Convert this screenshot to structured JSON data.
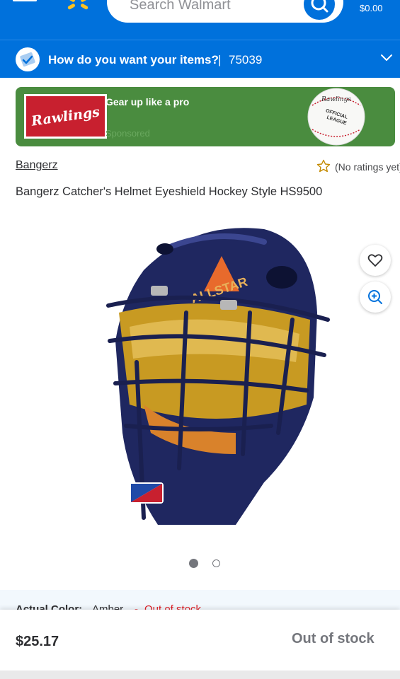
{
  "header": {
    "search_placeholder": "Search Walmart",
    "cart_total": "$0.00"
  },
  "delivery": {
    "question": "How do you want your items?",
    "separator": "|",
    "zip": "75039"
  },
  "banner": {
    "logo_text": "Rawlings",
    "title": "Gear up like a pro",
    "sponsored": "Sponsored",
    "ball_text_1": "Rawlings",
    "ball_text_2": "OFFICIAL",
    "ball_text_3": "LEAGUE"
  },
  "product": {
    "brand": "Bangerz",
    "rating_text": "(No ratings yet)",
    "title": "Bangerz Catcher's Helmet Eyeshield Hockey Style HS9500",
    "image_text": "ALLSTAR",
    "image_count": 2,
    "image_index": 1
  },
  "variant": {
    "label": "Actual Color:",
    "value": "Amber",
    "separator": "-",
    "status": "Out of stock"
  },
  "purchase": {
    "price": "$25.17",
    "button_label": "Out of stock"
  },
  "colors": {
    "brand_blue": "#0071dc",
    "spark_yellow": "#ffc220",
    "banner_green": "#4a8c3f",
    "out_of_stock_red": "#de1c24"
  }
}
